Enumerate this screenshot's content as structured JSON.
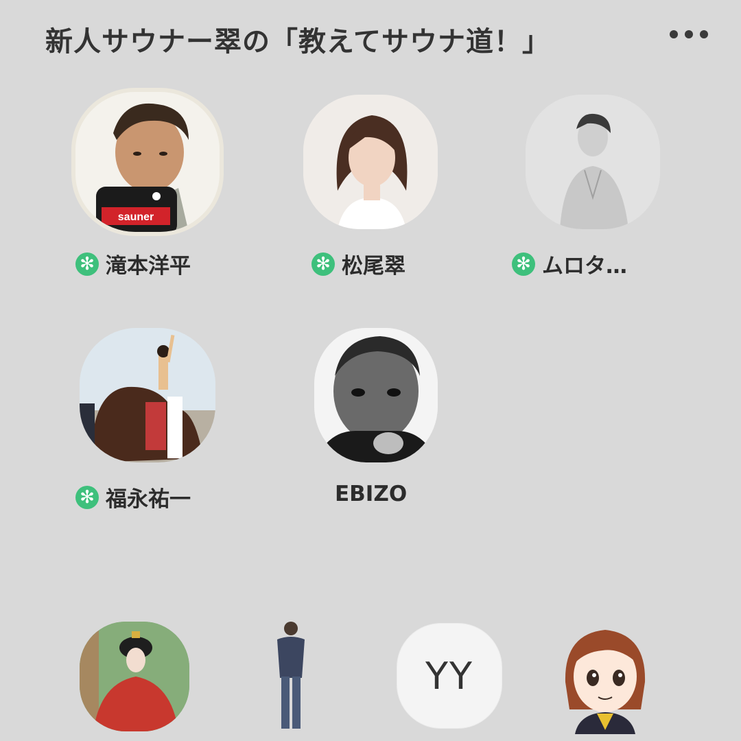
{
  "header": {
    "title": "新人サウナー翠の「教えてサウナ道！」",
    "more_icon": "more-horizontal-icon"
  },
  "members": [
    {
      "name": "滝本洋平",
      "badge": "✻",
      "badge_icon": "asterisk-badge-icon"
    },
    {
      "name": "松尾翠",
      "badge": "✻",
      "badge_icon": "asterisk-badge-icon"
    },
    {
      "name": "ムロタ…",
      "badge": "✻",
      "badge_icon": "asterisk-badge-icon"
    },
    {
      "name": "福永祐一",
      "badge": "✻",
      "badge_icon": "asterisk-badge-icon"
    },
    {
      "name": "EBIZO"
    }
  ],
  "bottom_row": [
    {
      "kind": "photo"
    },
    {
      "kind": "photo"
    },
    {
      "kind": "initials",
      "initials": "YY"
    },
    {
      "kind": "illustration"
    }
  ],
  "colors": {
    "background": "#d9d9d9",
    "badge": "#3ec07c",
    "text": "#2c2c2c"
  }
}
